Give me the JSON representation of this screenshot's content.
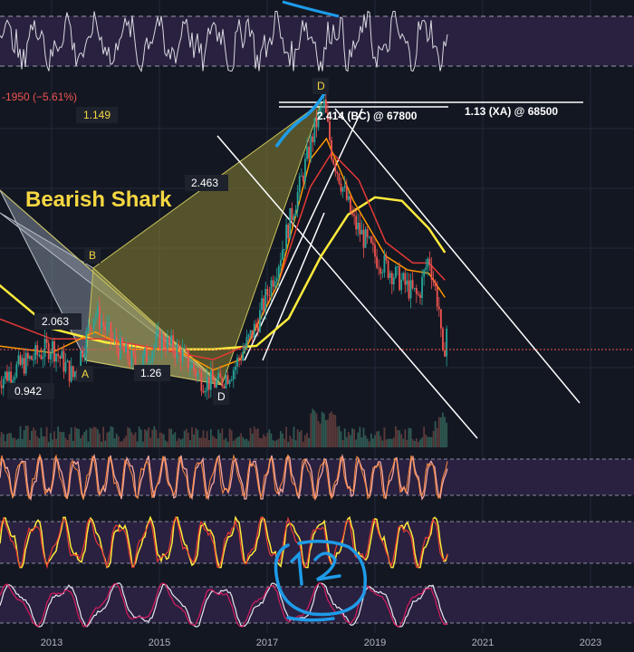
{
  "chart_data": {
    "type": "line",
    "x_ticks": [
      "2013",
      "2015",
      "2017",
      "2019",
      "2021",
      "2023"
    ],
    "price_change_label": "-1950 (−5.61%)",
    "pattern_title": "Bearish Shark",
    "point_labels": {
      "a": "A",
      "b": "B",
      "d1": "D",
      "d2": "D"
    },
    "ratio_labels": {
      "r1149": "1.149",
      "r2463": "2.463",
      "r2063": "2.063",
      "r126": "1.26",
      "r0942": "0.942",
      "bc": "2.414 (BC) @ 67800",
      "xa": "1.13 (XA) @ 68500"
    },
    "price_series": [
      {
        "x": 2012.0,
        "y": 1.0
      },
      {
        "x": 2012.5,
        "y": 1.25
      },
      {
        "x": 2013.0,
        "y": 1.5
      },
      {
        "x": 2013.4,
        "y": 1.05
      },
      {
        "x": 2013.8,
        "y": 2.0
      },
      {
        "x": 2014.2,
        "y": 1.5
      },
      {
        "x": 2014.6,
        "y": 1.2
      },
      {
        "x": 2015.0,
        "y": 1.6
      },
      {
        "x": 2015.4,
        "y": 1.4
      },
      {
        "x": 2015.8,
        "y": 1.0
      },
      {
        "x": 2016.1,
        "y": 0.95
      },
      {
        "x": 2016.4,
        "y": 1.2
      },
      {
        "x": 2016.8,
        "y": 1.8
      },
      {
        "x": 2017.2,
        "y": 2.7
      },
      {
        "x": 2017.6,
        "y": 3.8
      },
      {
        "x": 2017.9,
        "y": 4.7
      },
      {
        "x": 2018.05,
        "y": 5.0
      },
      {
        "x": 2018.2,
        "y": 4.3
      },
      {
        "x": 2018.6,
        "y": 3.3
      },
      {
        "x": 2019.0,
        "y": 2.8
      },
      {
        "x": 2019.4,
        "y": 2.5
      },
      {
        "x": 2019.8,
        "y": 2.2
      },
      {
        "x": 2020.0,
        "y": 2.8
      },
      {
        "x": 2020.2,
        "y": 2.0
      },
      {
        "x": 2020.25,
        "y": 1.2
      },
      {
        "x": 2020.35,
        "y": 1.9
      }
    ],
    "ma_yellow": [
      {
        "x": 2012.0,
        "y": 2.4
      },
      {
        "x": 2013.0,
        "y": 1.75
      },
      {
        "x": 2014.0,
        "y": 1.55
      },
      {
        "x": 2015.0,
        "y": 1.45
      },
      {
        "x": 2016.0,
        "y": 1.45
      },
      {
        "x": 2016.8,
        "y": 1.5
      },
      {
        "x": 2017.4,
        "y": 1.9
      },
      {
        "x": 2018.0,
        "y": 2.8
      },
      {
        "x": 2018.5,
        "y": 3.4
      },
      {
        "x": 2019.0,
        "y": 3.65
      },
      {
        "x": 2019.5,
        "y": 3.6
      },
      {
        "x": 2020.0,
        "y": 3.2
      },
      {
        "x": 2020.3,
        "y": 2.85
      }
    ],
    "ma_red": [
      {
        "x": 2012.0,
        "y": 1.9
      },
      {
        "x": 2013.0,
        "y": 1.6
      },
      {
        "x": 2014.0,
        "y": 1.6
      },
      {
        "x": 2015.0,
        "y": 1.45
      },
      {
        "x": 2016.0,
        "y": 1.3
      },
      {
        "x": 2016.6,
        "y": 1.5
      },
      {
        "x": 2017.2,
        "y": 2.4
      },
      {
        "x": 2017.8,
        "y": 3.8
      },
      {
        "x": 2018.2,
        "y": 4.3
      },
      {
        "x": 2018.7,
        "y": 3.9
      },
      {
        "x": 2019.2,
        "y": 3.0
      },
      {
        "x": 2019.7,
        "y": 2.7
      },
      {
        "x": 2020.0,
        "y": 2.7
      },
      {
        "x": 2020.3,
        "y": 2.45
      }
    ],
    "ma_orange": [
      {
        "x": 2012.0,
        "y": 1.5
      },
      {
        "x": 2013.0,
        "y": 1.4
      },
      {
        "x": 2013.8,
        "y": 1.7
      },
      {
        "x": 2014.5,
        "y": 1.45
      },
      {
        "x": 2015.3,
        "y": 1.45
      },
      {
        "x": 2016.0,
        "y": 1.15
      },
      {
        "x": 2016.5,
        "y": 1.3
      },
      {
        "x": 2017.2,
        "y": 2.4
      },
      {
        "x": 2017.8,
        "y": 4.2
      },
      {
        "x": 2018.1,
        "y": 4.5
      },
      {
        "x": 2018.6,
        "y": 3.6
      },
      {
        "x": 2019.2,
        "y": 2.8
      },
      {
        "x": 2019.6,
        "y": 2.6
      },
      {
        "x": 2020.0,
        "y": 2.55
      },
      {
        "x": 2020.3,
        "y": 2.2
      }
    ],
    "colors": {
      "background": "#131722",
      "indicator_band": "#2a2140",
      "price_up": "#26a69a",
      "price_down": "#ef5350",
      "ma_yellow": "#ffeb3b",
      "ma_red": "#e53935",
      "ma_orange": "#ff9800",
      "pattern_left": "#9aa3b3",
      "pattern_right": "#8a8533",
      "annotation_blue": "#1e9be8",
      "label_text": "#f5d742"
    }
  }
}
